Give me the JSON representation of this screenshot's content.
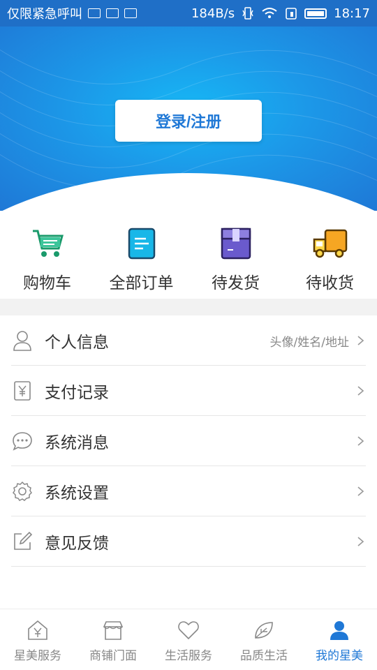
{
  "status_bar": {
    "carrier": "仅限紧急呼叫",
    "speed": "184B/s",
    "time": "18:17"
  },
  "header": {
    "login_label": "登录/注册"
  },
  "shortcuts": [
    {
      "label": "购物车",
      "icon": "shopping-cart-icon"
    },
    {
      "label": "全部订单",
      "icon": "order-list-icon"
    },
    {
      "label": "待发货",
      "icon": "package-box-icon"
    },
    {
      "label": "待收货",
      "icon": "delivery-truck-icon"
    }
  ],
  "menu": [
    {
      "label": "个人信息",
      "hint": "头像/姓名/地址",
      "icon": "user-icon"
    },
    {
      "label": "支付记录",
      "hint": "",
      "icon": "receipt-yen-icon"
    },
    {
      "label": "系统消息",
      "hint": "",
      "icon": "chat-bubble-icon"
    },
    {
      "label": "系统设置",
      "hint": "",
      "icon": "gear-icon"
    },
    {
      "label": "意见反馈",
      "hint": "",
      "icon": "edit-icon"
    }
  ],
  "bottom_nav": [
    {
      "label": "星美服务",
      "icon": "home-yen-icon",
      "active": false
    },
    {
      "label": "商铺门面",
      "icon": "shop-icon",
      "active": false
    },
    {
      "label": "生活服务",
      "icon": "heart-icon",
      "active": false
    },
    {
      "label": "品质生活",
      "icon": "leaf-icon",
      "active": false
    },
    {
      "label": "我的星美",
      "icon": "profile-icon",
      "active": true
    }
  ],
  "colors": {
    "accent": "#1f78d6",
    "header_light": "#17b7f5",
    "nav_inactive": "#888888"
  }
}
